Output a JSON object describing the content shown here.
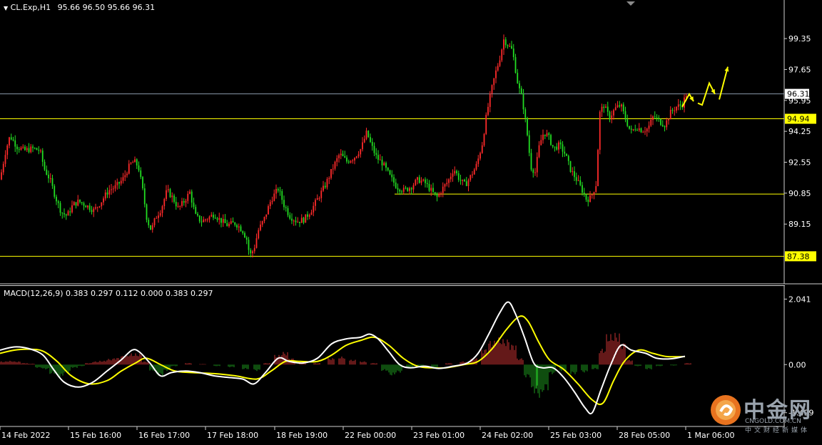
{
  "header": {
    "symbol": "CL.Exp,H1",
    "ohlc": "95.66 96.50 95.66 96.31",
    "indicator": "MACD(12,26,9) 0.383 0.297 0.112 0.000 0.383 0.297"
  },
  "colors": {
    "up_candle": "#ff2a2a",
    "down_candle": "#22dd22",
    "level_line": "#ffff00",
    "price_line": "#8a9aaa",
    "macd_line": "#ffffff",
    "signal_line": "#ffff00",
    "hist_up": "#c83232",
    "hist_down": "#1e9a1e"
  },
  "watermark": {
    "logo_text": "中金网",
    "site": "CNGOLD.COM.CN",
    "tagline": "中文财经新媒体"
  },
  "chart_data": [
    {
      "type": "candlestick",
      "title": "CL.Exp,H1",
      "y_ticks": [
        "99.35",
        "97.65",
        "95.95",
        "94.25",
        "92.55",
        "90.85",
        "89.15"
      ],
      "ylim": [
        86.1,
        101.0
      ],
      "x_ticks": [
        "14 Feb 2022",
        "15 Feb 16:00",
        "16 Feb 17:00",
        "17 Feb 18:00",
        "18 Feb 19:00",
        "22 Feb 00:00",
        "23 Feb 01:00",
        "24 Feb 02:00",
        "25 Feb 03:00",
        "28 Feb 05:00",
        "1 Mar 06:00"
      ],
      "current_price": "96.31",
      "horizontal_levels": [
        {
          "value": 94.94,
          "label": "94.94"
        },
        {
          "value": 90.8,
          "label": ""
        },
        {
          "value": 87.38,
          "label": "87.38"
        }
      ],
      "price_path": [
        [
          0,
          91.6
        ],
        [
          8,
          93.2
        ],
        [
          14,
          94.0
        ],
        [
          24,
          93.4
        ],
        [
          34,
          93.2
        ],
        [
          46,
          93.3
        ],
        [
          56,
          93.2
        ],
        [
          62,
          92.2
        ],
        [
          70,
          91.6
        ],
        [
          78,
          90.6
        ],
        [
          86,
          89.8
        ],
        [
          94,
          89.6
        ],
        [
          102,
          90.2
        ],
        [
          110,
          90.4
        ],
        [
          120,
          90.2
        ],
        [
          132,
          89.9
        ],
        [
          142,
          90.4
        ],
        [
          152,
          91.0
        ],
        [
          162,
          91.2
        ],
        [
          172,
          91.6
        ],
        [
          182,
          92.4
        ],
        [
          188,
          92.6
        ],
        [
          194,
          92.3
        ],
        [
          200,
          91.0
        ],
        [
          206,
          89.4
        ],
        [
          212,
          88.8
        ],
        [
          218,
          89.5
        ],
        [
          226,
          90.0
        ],
        [
          234,
          91.0
        ],
        [
          242,
          90.6
        ],
        [
          250,
          90.0
        ],
        [
          258,
          90.4
        ],
        [
          266,
          90.9
        ],
        [
          274,
          89.6
        ],
        [
          282,
          89.3
        ],
        [
          292,
          89.5
        ],
        [
          300,
          89.7
        ],
        [
          308,
          89.4
        ],
        [
          318,
          89.1
        ],
        [
          330,
          89.2
        ],
        [
          340,
          88.8
        ],
        [
          346,
          88.3
        ],
        [
          350,
          87.4
        ],
        [
          356,
          87.8
        ],
        [
          362,
          88.8
        ],
        [
          370,
          89.4
        ],
        [
          380,
          90.5
        ],
        [
          390,
          91.1
        ],
        [
          398,
          90.2
        ],
        [
          406,
          89.6
        ],
        [
          416,
          89.3
        ],
        [
          426,
          89.4
        ],
        [
          436,
          89.9
        ],
        [
          446,
          90.6
        ],
        [
          456,
          91.3
        ],
        [
          466,
          92.2
        ],
        [
          476,
          93.0
        ],
        [
          486,
          92.6
        ],
        [
          496,
          92.8
        ],
        [
          506,
          93.3
        ],
        [
          514,
          94.2
        ],
        [
          520,
          93.5
        ],
        [
          528,
          92.8
        ],
        [
          536,
          92.5
        ],
        [
          546,
          91.8
        ],
        [
          556,
          91.2
        ],
        [
          566,
          91.0
        ],
        [
          576,
          91.2
        ],
        [
          586,
          91.6
        ],
        [
          596,
          91.4
        ],
        [
          604,
          91.0
        ],
        [
          612,
          90.6
        ],
        [
          620,
          91.1
        ],
        [
          628,
          91.5
        ],
        [
          636,
          92.2
        ],
        [
          644,
          91.6
        ],
        [
          652,
          91.3
        ],
        [
          660,
          91.8
        ],
        [
          668,
          92.4
        ],
        [
          676,
          93.6
        ],
        [
          682,
          95.2
        ],
        [
          688,
          96.4
        ],
        [
          694,
          97.4
        ],
        [
          700,
          98.2
        ],
        [
          706,
          99.3
        ],
        [
          712,
          99.0
        ],
        [
          718,
          98.7
        ],
        [
          726,
          96.8
        ],
        [
          732,
          96.0
        ],
        [
          738,
          94.4
        ],
        [
          744,
          92.3
        ],
        [
          750,
          92.0
        ],
        [
          756,
          93.5
        ],
        [
          762,
          94.2
        ],
        [
          768,
          94.0
        ],
        [
          776,
          93.3
        ],
        [
          784,
          93.5
        ],
        [
          792,
          93.0
        ],
        [
          800,
          92.1
        ],
        [
          808,
          91.6
        ],
        [
          816,
          91.0
        ],
        [
          822,
          90.5
        ],
        [
          828,
          90.6
        ],
        [
          832,
          91.0
        ],
        [
          836,
          91.4
        ],
        [
          840,
          95.2
        ],
        [
          846,
          95.7
        ],
        [
          854,
          95.0
        ],
        [
          862,
          95.5
        ],
        [
          870,
          95.7
        ],
        [
          876,
          95.0
        ],
        [
          884,
          94.2
        ],
        [
          892,
          94.5
        ],
        [
          900,
          94.3
        ],
        [
          908,
          94.4
        ],
        [
          916,
          95.1
        ],
        [
          924,
          94.8
        ],
        [
          932,
          94.6
        ],
        [
          940,
          95.3
        ],
        [
          948,
          95.6
        ],
        [
          956,
          95.7
        ],
        [
          962,
          96.31
        ]
      ],
      "projection_arrows": [
        [
          [
            956,
            95.6
          ],
          [
            966,
            96.3
          ],
          [
            972,
            95.9
          ]
        ],
        [
          [
            978,
            95.8
          ],
          [
            984,
            95.7
          ],
          [
            994,
            96.9
          ],
          [
            1002,
            96.3
          ]
        ],
        [
          [
            1008,
            96.0
          ],
          [
            1020,
            97.8
          ]
        ]
      ]
    },
    {
      "type": "line",
      "title": "MACD(12,26,9)",
      "y_ticks": [
        "2.041",
        "0.00",
        "-1.499"
      ],
      "ylim": [
        -1.75,
        2.25
      ],
      "series": [
        {
          "name": "MACD",
          "values": [
            [
              0,
              0.45
            ],
            [
              20,
              0.55
            ],
            [
              40,
              0.5
            ],
            [
              60,
              0.3
            ],
            [
              75,
              -0.15
            ],
            [
              90,
              -0.55
            ],
            [
              110,
              -0.7
            ],
            [
              130,
              -0.55
            ],
            [
              150,
              -0.2
            ],
            [
              170,
              0.15
            ],
            [
              185,
              0.45
            ],
            [
              195,
              0.4
            ],
            [
              210,
              0.05
            ],
            [
              225,
              -0.35
            ],
            [
              240,
              -0.25
            ],
            [
              260,
              -0.2
            ],
            [
              280,
              -0.25
            ],
            [
              300,
              -0.35
            ],
            [
              320,
              -0.4
            ],
            [
              340,
              -0.45
            ],
            [
              356,
              -0.6
            ],
            [
              372,
              -0.25
            ],
            [
              390,
              0.2
            ],
            [
              405,
              0.1
            ],
            [
              425,
              0.05
            ],
            [
              445,
              0.2
            ],
            [
              465,
              0.65
            ],
            [
              485,
              0.8
            ],
            [
              505,
              0.85
            ],
            [
              518,
              0.95
            ],
            [
              530,
              0.8
            ],
            [
              545,
              0.4
            ],
            [
              560,
              0.0
            ],
            [
              575,
              -0.1
            ],
            [
              595,
              -0.05
            ],
            [
              615,
              -0.12
            ],
            [
              635,
              -0.05
            ],
            [
              655,
              0.05
            ],
            [
              670,
              0.35
            ],
            [
              685,
              0.95
            ],
            [
              700,
              1.6
            ],
            [
              712,
              1.95
            ],
            [
              722,
              1.6
            ],
            [
              735,
              0.85
            ],
            [
              748,
              0.05
            ],
            [
              760,
              -0.1
            ],
            [
              775,
              -0.1
            ],
            [
              790,
              -0.4
            ],
            [
              805,
              -0.85
            ],
            [
              820,
              -1.35
            ],
            [
              830,
              -1.5
            ],
            [
              842,
              -0.8
            ],
            [
              856,
              0.0
            ],
            [
              870,
              0.6
            ],
            [
              885,
              0.45
            ],
            [
              905,
              0.35
            ],
            [
              920,
              0.2
            ],
            [
              940,
              0.18
            ],
            [
              960,
              0.26
            ]
          ]
        },
        {
          "name": "Signal",
          "values": [
            [
              0,
              0.35
            ],
            [
              20,
              0.45
            ],
            [
              40,
              0.48
            ],
            [
              60,
              0.42
            ],
            [
              80,
              0.1
            ],
            [
              100,
              -0.35
            ],
            [
              125,
              -0.6
            ],
            [
              150,
              -0.5
            ],
            [
              170,
              -0.2
            ],
            [
              190,
              0.05
            ],
            [
              205,
              0.2
            ],
            [
              225,
              0.0
            ],
            [
              245,
              -0.2
            ],
            [
              270,
              -0.25
            ],
            [
              300,
              -0.28
            ],
            [
              330,
              -0.35
            ],
            [
              360,
              -0.45
            ],
            [
              380,
              -0.2
            ],
            [
              400,
              0.1
            ],
            [
              420,
              0.1
            ],
            [
              445,
              0.1
            ],
            [
              465,
              0.3
            ],
            [
              485,
              0.6
            ],
            [
              505,
              0.75
            ],
            [
              525,
              0.85
            ],
            [
              545,
              0.6
            ],
            [
              565,
              0.2
            ],
            [
              585,
              -0.05
            ],
            [
              605,
              -0.1
            ],
            [
              625,
              -0.1
            ],
            [
              650,
              0.0
            ],
            [
              670,
              0.1
            ],
            [
              690,
              0.5
            ],
            [
              710,
              1.1
            ],
            [
              728,
              1.5
            ],
            [
              740,
              1.35
            ],
            [
              755,
              0.7
            ],
            [
              770,
              0.15
            ],
            [
              790,
              -0.15
            ],
            [
              810,
              -0.6
            ],
            [
              830,
              -1.1
            ],
            [
              845,
              -1.2
            ],
            [
              860,
              -0.5
            ],
            [
              875,
              0.1
            ],
            [
              895,
              0.45
            ],
            [
              915,
              0.35
            ],
            [
              935,
              0.25
            ],
            [
              960,
              0.25
            ]
          ]
        }
      ],
      "histogram": [
        [
          0,
          0.1
        ],
        [
          10,
          0.12
        ],
        [
          20,
          0.1
        ],
        [
          30,
          0.05
        ],
        [
          40,
          0.03
        ],
        [
          50,
          -0.1
        ],
        [
          60,
          -0.15
        ],
        [
          70,
          -0.3
        ],
        [
          80,
          -0.4
        ],
        [
          90,
          -0.25
        ],
        [
          100,
          -0.1
        ],
        [
          110,
          -0.05
        ],
        [
          120,
          0.05
        ],
        [
          130,
          0.1
        ],
        [
          140,
          0.12
        ],
        [
          150,
          0.18
        ],
        [
          160,
          0.22
        ],
        [
          170,
          0.28
        ],
        [
          180,
          0.35
        ],
        [
          190,
          0.35
        ],
        [
          200,
          0.1
        ],
        [
          210,
          -0.2
        ],
        [
          220,
          -0.35
        ],
        [
          230,
          -0.2
        ],
        [
          240,
          -0.05
        ],
        [
          260,
          0.05
        ],
        [
          280,
          0.02
        ],
        [
          300,
          -0.05
        ],
        [
          320,
          -0.08
        ],
        [
          340,
          -0.15
        ],
        [
          356,
          -0.2
        ],
        [
          370,
          0.05
        ],
        [
          385,
          0.3
        ],
        [
          395,
          0.4
        ],
        [
          405,
          0.2
        ],
        [
          420,
          0.05
        ],
        [
          440,
          0.05
        ],
        [
          460,
          0.2
        ],
        [
          475,
          0.25
        ],
        [
          490,
          0.15
        ],
        [
          505,
          0.1
        ],
        [
          520,
          0.05
        ],
        [
          535,
          -0.2
        ],
        [
          545,
          -0.35
        ],
        [
          555,
          -0.25
        ],
        [
          570,
          -0.1
        ],
        [
          585,
          -0.05
        ],
        [
          605,
          -0.1
        ],
        [
          625,
          0.05
        ],
        [
          645,
          0.1
        ],
        [
          660,
          0.2
        ],
        [
          675,
          0.5
        ],
        [
          685,
          0.75
        ],
        [
          695,
          0.85
        ],
        [
          705,
          0.8
        ],
        [
          715,
          0.65
        ],
        [
          725,
          0.2
        ],
        [
          735,
          -0.4
        ],
        [
          745,
          -0.9
        ],
        [
          752,
          -1.05
        ],
        [
          760,
          -0.8
        ],
        [
          770,
          -0.3
        ],
        [
          785,
          -0.2
        ],
        [
          800,
          -0.3
        ],
        [
          815,
          -0.25
        ],
        [
          830,
          -0.15
        ],
        [
          840,
          0.5
        ],
        [
          850,
          0.95
        ],
        [
          860,
          1.0
        ],
        [
          868,
          0.7
        ],
        [
          878,
          0.15
        ],
        [
          890,
          -0.05
        ],
        [
          905,
          -0.15
        ],
        [
          920,
          -0.05
        ],
        [
          940,
          -0.03
        ],
        [
          960,
          0.05
        ]
      ]
    }
  ]
}
